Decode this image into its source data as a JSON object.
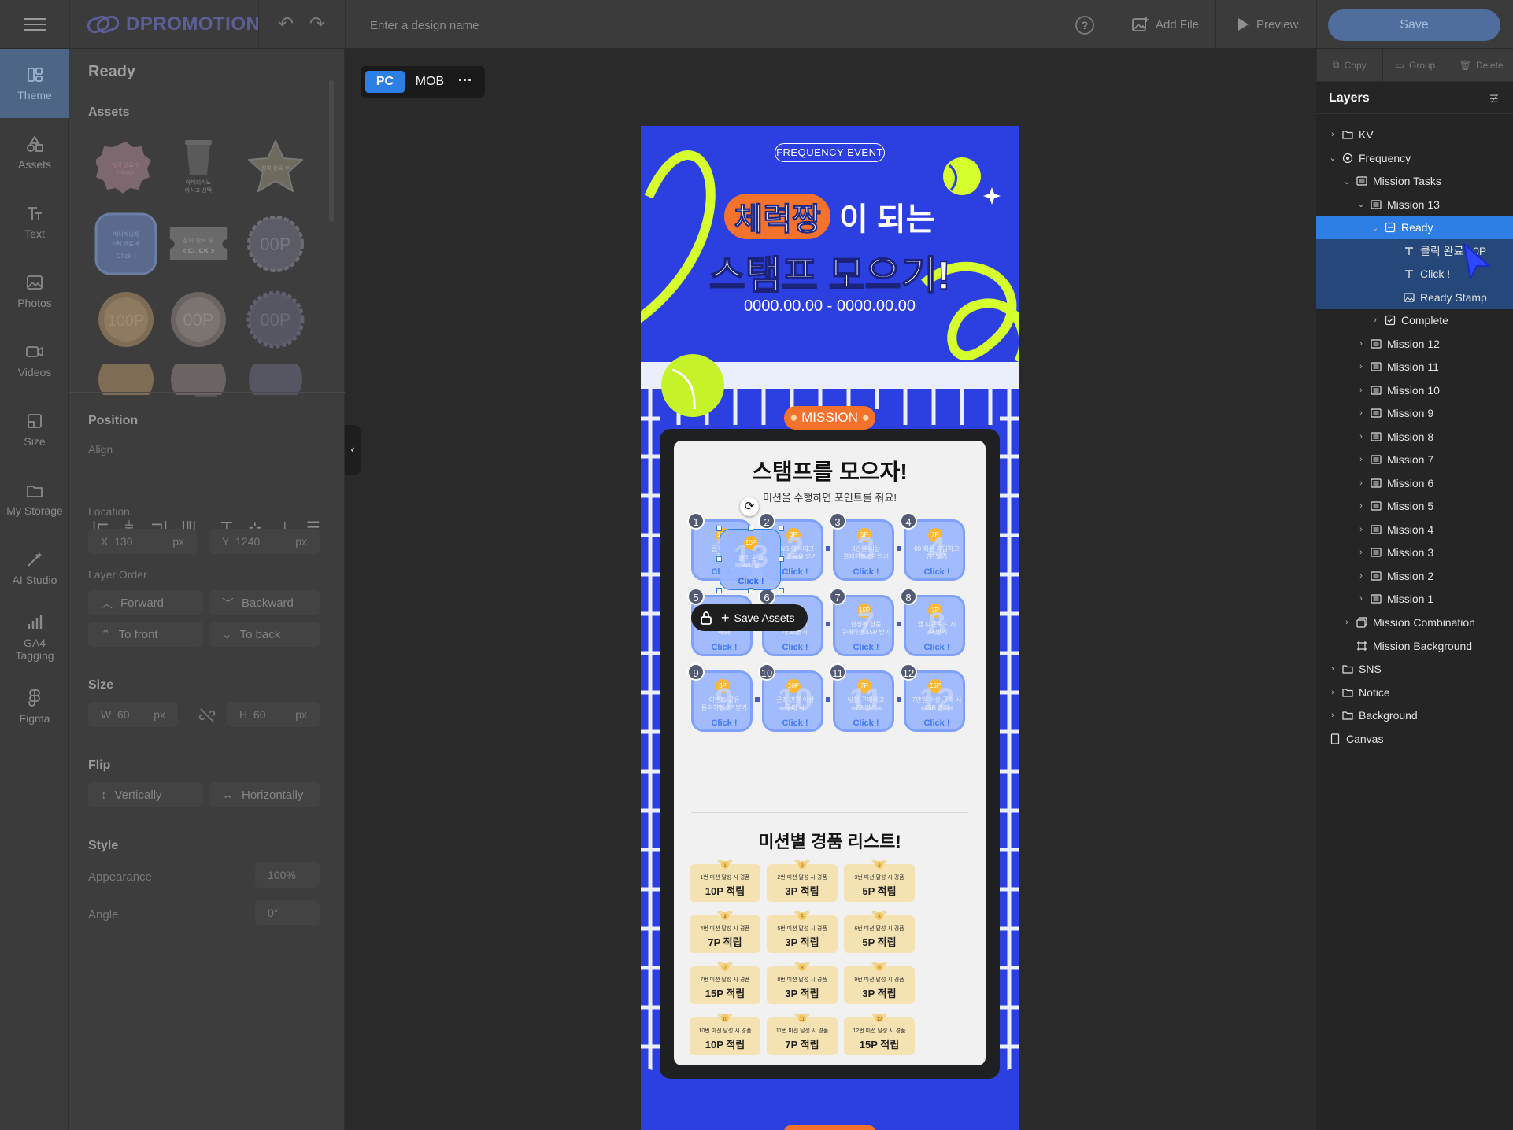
{
  "brand": {
    "name": "DPROMOTION",
    "accent": "#2d7fe6"
  },
  "topbar": {
    "design_name_placeholder": "Enter a design name",
    "help_label": "?",
    "add_file_label": "Add File",
    "preview_label": "Preview",
    "save_label": "Save"
  },
  "sidebar": {
    "items": [
      {
        "label": "Theme",
        "icon": "theme-icon",
        "active": true
      },
      {
        "label": "Assets",
        "icon": "shapes-icon"
      },
      {
        "label": "Text",
        "icon": "text-icon"
      },
      {
        "label": "Photos",
        "icon": "photo-icon"
      },
      {
        "label": "Videos",
        "icon": "video-icon"
      },
      {
        "label": "Size",
        "icon": "size-icon"
      },
      {
        "label": "My Storage",
        "icon": "folder-icon"
      },
      {
        "label": "AI Studio",
        "icon": "magic-wand-icon"
      },
      {
        "label": "GA4 Tagging",
        "icon": "bar-chart-icon"
      },
      {
        "label": "Figma",
        "icon": "figma-icon"
      }
    ]
  },
  "left_panel": {
    "status": "Ready",
    "assets_heading": "Assets",
    "assets": [
      {
        "type": "badge",
        "text": "참여 완료 후\n선택하기"
      },
      {
        "type": "cup",
        "text": "아메리카노\n마시고 선택"
      },
      {
        "type": "star",
        "text": "참여 완료 후\n보상받기"
      },
      {
        "type": "rounded",
        "text": "매니저님께\n선택 완료 후\nClick !"
      },
      {
        "type": "ticket",
        "text": "참여 완료 후\n< CLICK >"
      },
      {
        "type": "seal",
        "text": "00P"
      },
      {
        "type": "coin-gold",
        "text": "100P"
      },
      {
        "type": "coin-silver",
        "text": "00P"
      },
      {
        "type": "seal-dark",
        "text": "00P"
      }
    ],
    "position_heading": "Position",
    "align_label": "Align",
    "location_label": "Location",
    "x_label": "X",
    "x_value": "130",
    "x_unit": "px",
    "y_label": "Y",
    "y_value": "1240",
    "y_unit": "px",
    "layer_order_label": "Layer Order",
    "forward_label": "Forward",
    "backward_label": "Backward",
    "to_front_label": "To front",
    "to_back_label": "To back",
    "size_heading": "Size",
    "w_label": "W",
    "w_value": "60",
    "w_unit": "px",
    "h_label": "H",
    "h_value": "60",
    "h_unit": "px",
    "flip_heading": "Flip",
    "vertically_label": "Vertically",
    "horizontally_label": "Horizontally",
    "style_heading": "Style",
    "appearance_label": "Appearance",
    "appearance_value": "100%",
    "angle_label": "Angle",
    "angle_value": "0°"
  },
  "canvas": {
    "view_pc": "PC",
    "view_mob": "MOB",
    "view_more": "···"
  },
  "artwork": {
    "badge": "FREQUENCY  EVENT",
    "title_highlight": "체력짱",
    "title_rest": "이 되는",
    "title_line2": "스탬프 모으기!",
    "dates": "0000.00.00 - 0000.00.00",
    "mission_pill": "MISSION",
    "card_title": "스탬프를 모으자!",
    "card_subtitle": "미션을 수행하면 포인트를 줘요!",
    "click_label": "Click !",
    "stamps": [
      {
        "n": "1",
        "pts": "10P",
        "desc": "클릭 완료\n주세요"
      },
      {
        "n": "2",
        "pts": "3P",
        "desc": "SNS 해시태그\n게시물 공유 받기"
      },
      {
        "n": "3",
        "pts": "5P",
        "desc": "3만원 이상\n결제하면 5P 받기"
      },
      {
        "n": "4",
        "pts": "7P",
        "desc": "00 회원 가입하고\n7P 받기"
      },
      {
        "n": "5",
        "pts": "3P",
        "desc": "출석체크\n하기"
      },
      {
        "n": "6",
        "pts": "3P",
        "desc": "친구 초대\n하고 받기"
      },
      {
        "n": "7",
        "pts": "15P",
        "desc": "한정판 상품\n구매하면 15P 받기"
      },
      {
        "n": "8",
        "pts": "3P",
        "desc": "앱 다운로드 시\n3P 받기"
      },
      {
        "n": "9",
        "pts": "3P",
        "desc": "이벤트 공유\n동의하면 3P 받기"
      },
      {
        "n": "10",
        "pts": "10P",
        "desc": "굿즈 만원 이상\n구매 시"
      },
      {
        "n": "11",
        "pts": "7P",
        "desc": "당첨 구매하고\n7P 받기"
      },
      {
        "n": "12",
        "pts": "15P",
        "desc": "7만원 이상 구매 시\n15P 받기"
      }
    ],
    "selected_stamp": {
      "big": "13",
      "pts": "10P",
      "desc": "클릭 완료\n주세요"
    },
    "save_assets_label": "Save Assets",
    "prize_title": "미션별 경품 리스트!",
    "prizes": [
      {
        "n": "1",
        "label": "1번 미션 달성 시 경품",
        "value": "10P 적립"
      },
      {
        "n": "2",
        "label": "2번 미션 달성 시 경품",
        "value": "3P 적립"
      },
      {
        "n": "3",
        "label": "3번 미션 달성 시 경품",
        "value": "5P 적립"
      },
      {
        "n": "4",
        "label": "4번 미션 달성 시 경품",
        "value": "7P 적립"
      },
      {
        "n": "5",
        "label": "5번 미션 달성 시 경품",
        "value": "3P 적립"
      },
      {
        "n": "6",
        "label": "6번 미션 달성 시 경품",
        "value": "5P 적립"
      },
      {
        "n": "7",
        "label": "7번 미션 달성 시 경품",
        "value": "15P 적립"
      },
      {
        "n": "8",
        "label": "8번 미션 달성 시 경품",
        "value": "3P 적립"
      },
      {
        "n": "9",
        "label": "9번 미션 달성 시 경품",
        "value": "3P 적립"
      },
      {
        "n": "10",
        "label": "10번 미션 달성 시 경품",
        "value": "10P 적립"
      },
      {
        "n": "11",
        "label": "11번 미션 달성 시 경품",
        "value": "7P 적립"
      },
      {
        "n": "12",
        "label": "12번 미션 달성 시 경품",
        "value": "15P 적립"
      }
    ]
  },
  "right_panel": {
    "copy_label": "Copy",
    "group_label": "Group",
    "delete_label": "Delete",
    "layers_title": "Layers",
    "layers": [
      {
        "label": "KV",
        "depth": 0,
        "icon": "folder-icon",
        "chev": "›"
      },
      {
        "label": "Frequency",
        "depth": 0,
        "icon": "component-icon",
        "chev": "⌄"
      },
      {
        "label": "Mission Tasks",
        "depth": 1,
        "icon": "list-icon",
        "chev": "⌄"
      },
      {
        "label": "Mission 13",
        "depth": 2,
        "icon": "list-icon",
        "chev": "⌄"
      },
      {
        "label": "Ready",
        "depth": 3,
        "icon": "frame-icon",
        "chev": "⌄",
        "state": "selected"
      },
      {
        "label": "클릭 완료 10P",
        "depth": 4,
        "icon": "text-icon",
        "chev": "",
        "state": "child"
      },
      {
        "label": "Click !",
        "depth": 4,
        "icon": "text-icon",
        "chev": "",
        "state": "child"
      },
      {
        "label": "Ready Stamp",
        "depth": 4,
        "icon": "image-icon",
        "chev": "",
        "state": "child"
      },
      {
        "label": "Complete",
        "depth": 3,
        "icon": "check-frame-icon",
        "chev": "›"
      },
      {
        "label": "Mission 12",
        "depth": 2,
        "icon": "list-icon",
        "chev": "›"
      },
      {
        "label": "Mission 11",
        "depth": 2,
        "icon": "list-icon",
        "chev": "›"
      },
      {
        "label": "Mission 10",
        "depth": 2,
        "icon": "list-icon",
        "chev": "›"
      },
      {
        "label": "Mission 9",
        "depth": 2,
        "icon": "list-icon",
        "chev": "›"
      },
      {
        "label": "Mission 8",
        "depth": 2,
        "icon": "list-icon",
        "chev": "›"
      },
      {
        "label": "Mission 7",
        "depth": 2,
        "icon": "list-icon",
        "chev": "›"
      },
      {
        "label": "Mission 6",
        "depth": 2,
        "icon": "list-icon",
        "chev": "›"
      },
      {
        "label": "Mission 5",
        "depth": 2,
        "icon": "list-icon",
        "chev": "›"
      },
      {
        "label": "Mission 4",
        "depth": 2,
        "icon": "list-icon",
        "chev": "›"
      },
      {
        "label": "Mission 3",
        "depth": 2,
        "icon": "list-icon",
        "chev": "›"
      },
      {
        "label": "Mission 2",
        "depth": 2,
        "icon": "list-icon",
        "chev": "›"
      },
      {
        "label": "Mission 1",
        "depth": 2,
        "icon": "list-icon",
        "chev": "›"
      },
      {
        "label": "Mission Combination",
        "depth": 1,
        "icon": "stack-icon",
        "chev": "›"
      },
      {
        "label": "Mission Background",
        "depth": 1,
        "icon": "frame-corners-icon",
        "chev": ""
      },
      {
        "label": "SNS",
        "depth": 0,
        "icon": "folder-icon",
        "chev": "›"
      },
      {
        "label": "Notice",
        "depth": 0,
        "icon": "folder-icon",
        "chev": "›"
      },
      {
        "label": "Background",
        "depth": 0,
        "icon": "folder-icon",
        "chev": "›"
      },
      {
        "label": "Canvas",
        "depth": -1,
        "icon": "rect-icon",
        "chev": ""
      }
    ]
  }
}
